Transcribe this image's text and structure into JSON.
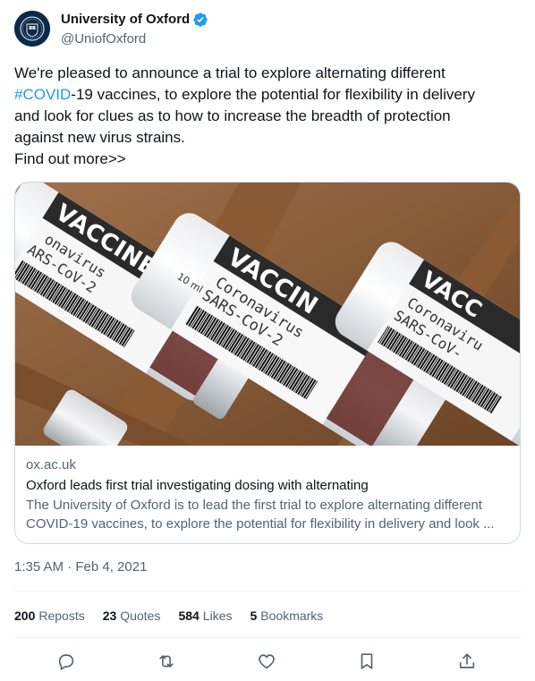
{
  "author": {
    "display_name": "University of Oxford",
    "handle": "@UniofOxford"
  },
  "tweet": {
    "line1": "We're pleased to announce a trial to explore alternating different",
    "hashtag": "#COVID",
    "line2_rest": "-19 vaccines, to explore the potential for flexibility in delivery",
    "line3": "and look for clues as to how to increase the breadth of protection",
    "line4": "against new virus strains.",
    "line5": "Find out more>>"
  },
  "card": {
    "domain": "ox.ac.uk",
    "title": "Oxford leads first trial investigating dosing with alternating",
    "description_line1": "The University of Oxford is to lead the first trial to explore alternating different",
    "description_line2": "COVID-19 vaccines, to explore the potential for flexibility in delivery and look ...",
    "image_labels": {
      "vial_left": "VACCINE",
      "vial_left_sub1": "onavirus",
      "vial_left_sub2": "ARS-CoV-2",
      "vial_center": "VACCIN",
      "vial_center_sub1": "Coronavirus",
      "vial_center_sub2": "SARS-CoV-2",
      "vial_center_volume": "10 ml",
      "vial_right": "VACC",
      "vial_right_sub1": "Coronaviru",
      "vial_right_sub2": "SARS-CoV-"
    }
  },
  "timestamp": "1:35 AM · Feb 4, 2021",
  "stats": {
    "reposts_count": "200",
    "reposts_label": "Reposts",
    "quotes_count": "23",
    "quotes_label": "Quotes",
    "likes_count": "584",
    "likes_label": "Likes",
    "bookmarks_count": "5",
    "bookmarks_label": "Bookmarks"
  },
  "icons": {
    "verified": "verified-badge-icon",
    "reply": "reply-icon",
    "repost": "repost-icon",
    "like": "heart-icon",
    "bookmark": "bookmark-icon",
    "share": "share-icon"
  },
  "colors": {
    "accent": "#1d9bf0",
    "text": "#0f1419",
    "secondary": "#536471",
    "border": "#cfd9de"
  }
}
